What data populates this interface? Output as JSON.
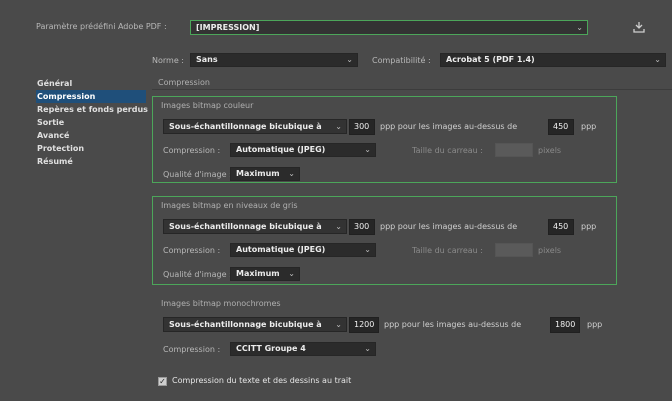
{
  "header": {
    "preset_label": "Paramètre prédéfini Adobe PDF :",
    "preset_value": "[IMPRESSION]",
    "standard_label": "Norme :",
    "standard_value": "Sans",
    "compat_label": "Compatibilité :",
    "compat_value": "Acrobat 5 (PDF 1.4)"
  },
  "sidebar": {
    "items": [
      {
        "label": "Général"
      },
      {
        "label": "Compression"
      },
      {
        "label": "Repères et fonds perdus"
      },
      {
        "label": "Sortie"
      },
      {
        "label": "Avancé"
      },
      {
        "label": "Protection"
      },
      {
        "label": "Résumé"
      }
    ],
    "active_index": 1
  },
  "panel": {
    "title": "Compression",
    "color": {
      "title": "Images bitmap couleur",
      "method": "Sous-échantillonnage bicubique à",
      "ppi": "300",
      "above_text": "ppp pour les images au-dessus de",
      "above_ppi": "450",
      "unit": "ppp",
      "compression_label": "Compression :",
      "compression_value": "Automatique (JPEG)",
      "tile_label": "Taille du carreau :",
      "tile_unit": "pixels",
      "quality_label": "Qualité d'image :",
      "quality_value": "Maximum"
    },
    "gray": {
      "title": "Images bitmap en niveaux de gris",
      "method": "Sous-échantillonnage bicubique à",
      "ppi": "300",
      "above_text": "ppp pour les images au-dessus de",
      "above_ppi": "450",
      "unit": "ppp",
      "compression_label": "Compression :",
      "compression_value": "Automatique (JPEG)",
      "tile_label": "Taille du carreau :",
      "tile_unit": "pixels",
      "quality_label": "Qualité d'image :",
      "quality_value": "Maximum"
    },
    "mono": {
      "title": "Images bitmap monochromes",
      "method": "Sous-échantillonnage bicubique à",
      "ppi": "1200",
      "above_text": "ppp pour les images au-dessus de",
      "above_ppi": "1800",
      "unit": "ppp",
      "compression_label": "Compression :",
      "compression_value": "CCITT Groupe 4"
    },
    "text_compression": {
      "label": "Compression du texte et des dessins au trait",
      "checked": true
    }
  },
  "colors": {
    "highlight_green": "#4ca65a",
    "selection_blue": "#1f4f7a"
  },
  "icons": {
    "save_preset": "save-preset-icon"
  }
}
